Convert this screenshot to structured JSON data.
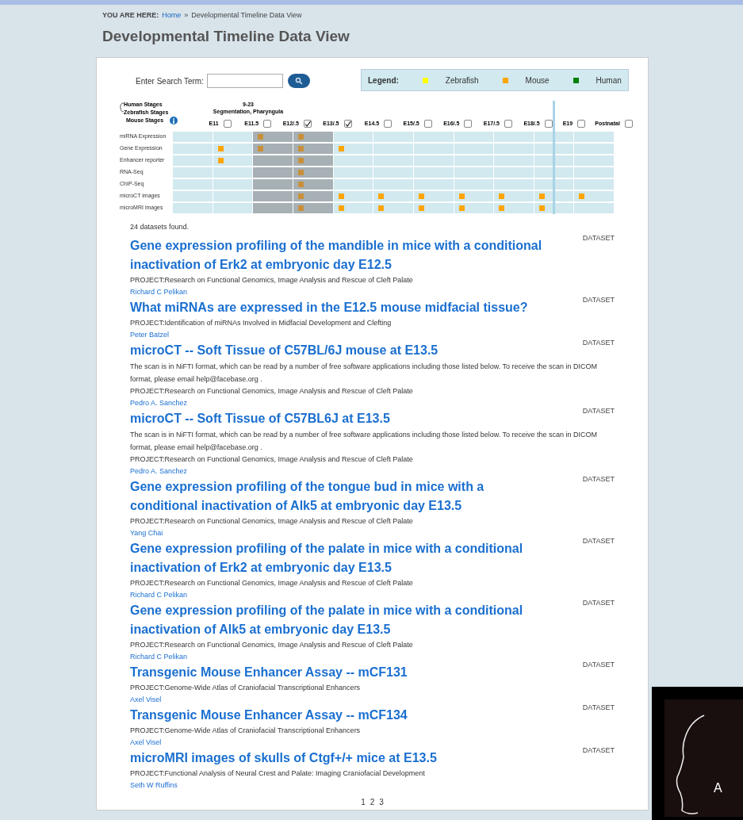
{
  "breadcrumb": {
    "label": "YOU ARE HERE:",
    "items": [
      {
        "text": "Home",
        "kind": "link"
      },
      {
        "text": "»",
        "kind": "sep"
      },
      {
        "text": "Developmental Timeline Data View",
        "kind": "current"
      }
    ]
  },
  "page_title": "Developmental Timeline Data View",
  "search": {
    "label": "Enter Search Term:"
  },
  "legend": {
    "title": "Legend:",
    "items": [
      {
        "label": "Zebrafish",
        "color": "#ffff00"
      },
      {
        "label": "Mouse",
        "color": "#ffa500"
      },
      {
        "label": "Human",
        "color": "#008000"
      }
    ]
  },
  "timeline": {
    "stage_labels": [
      "Human Stages",
      "Zebrafish Stages",
      "Mouse Stages"
    ],
    "zebrafish_stage": [
      "9-23",
      "Segmentation, Pharyngula"
    ],
    "columns": [
      {
        "label": "E11",
        "selected": false
      },
      {
        "label": "E11.5",
        "selected": false
      },
      {
        "label": "E12/.5",
        "selected": true
      },
      {
        "label": "E13/.5",
        "selected": true
      },
      {
        "label": "E14.5",
        "selected": false
      },
      {
        "label": "E15/.5",
        "selected": false
      },
      {
        "label": "E16/.5",
        "selected": false
      },
      {
        "label": "E17/.5",
        "selected": false
      },
      {
        "label": "E18/.5",
        "selected": false
      },
      {
        "label": "E19",
        "selected": false
      },
      {
        "label": "Postnatal",
        "selected": false
      }
    ],
    "rows": [
      {
        "label": "miRNA Expression",
        "cells": [
          false,
          false,
          true,
          true,
          false,
          false,
          false,
          false,
          false,
          false,
          false
        ]
      },
      {
        "label": "Gene Expression",
        "cells": [
          false,
          true,
          true,
          true,
          true,
          false,
          false,
          false,
          false,
          false,
          false
        ]
      },
      {
        "label": "Enhancer reporter",
        "cells": [
          false,
          true,
          false,
          true,
          false,
          false,
          false,
          false,
          false,
          false,
          false
        ]
      },
      {
        "label": "RNA-Seq",
        "cells": [
          false,
          false,
          false,
          true,
          false,
          false,
          false,
          false,
          false,
          false,
          false
        ]
      },
      {
        "label": "ChIP-Seq",
        "cells": [
          false,
          false,
          false,
          true,
          false,
          false,
          false,
          false,
          false,
          false,
          false
        ]
      },
      {
        "label": "microCT images",
        "cells": [
          false,
          false,
          false,
          true,
          true,
          true,
          true,
          true,
          true,
          true,
          true
        ]
      },
      {
        "label": "microMRI images",
        "cells": [
          false,
          false,
          false,
          true,
          true,
          true,
          true,
          true,
          true,
          true,
          false
        ]
      }
    ]
  },
  "results_count": "24 datasets found.",
  "datasets": [
    {
      "title": "Gene expression profiling of the mandible in mice with a conditional inactivation of Erk2 at embryonic day E12.5",
      "type": "DATASET",
      "project": "PROJECT:Research on Functional Genomics, Image Analysis and Rescue of Cleft Palate",
      "author": "Richard C Pelikan"
    },
    {
      "title": "What miRNAs are expressed in the E12.5 mouse midfacial tissue?",
      "type": "DATASET",
      "project": "PROJECT:Identification of miRNAs Involved in Midfacial Development and Clefting",
      "author": "Peter Batzel"
    },
    {
      "title": "microCT -- Soft Tissue of C57BL/6J mouse at E13.5",
      "type": "DATASET",
      "description": "The scan is in NiFTI format, which can be read by a number of free software applications including those listed below.  To receive the scan in DICOM format, please email help@facebase.org .",
      "project": "PROJECT:Research on Functional Genomics, Image Analysis and Rescue of Cleft Palate",
      "author": "Pedro A. Sanchez"
    },
    {
      "title": "microCT -- Soft Tissue of C57BL6J at E13.5",
      "type": "DATASET",
      "description": "The scan is in NiFTI format, which can be read by a number of free software applications including those listed below.  To receive the scan in DICOM format, please email help@facebase.org .",
      "project": "PROJECT:Research on Functional Genomics, Image Analysis and Rescue of Cleft Palate",
      "author": "Pedro A. Sanchez"
    },
    {
      "title": "Gene expression profiling of the tongue bud in mice with a conditional inactivation of Alk5 at embryonic day E13.5",
      "type": "DATASET",
      "project": "PROJECT:Research on Functional Genomics, Image Analysis and Rescue of Cleft Palate",
      "author": "Yang Chai"
    },
    {
      "title": "Gene expression profiling of the palate in mice with a conditional inactivation of Erk2 at embryonic day E13.5",
      "type": "DATASET",
      "project": "PROJECT:Research on Functional Genomics, Image Analysis and Rescue of Cleft Palate",
      "author": "Richard C Pelikan"
    },
    {
      "title": "Gene expression profiling of the palate in mice with a conditional inactivation of Alk5 at embryonic day E13.5",
      "type": "DATASET",
      "project": "PROJECT:Research on Functional Genomics, Image Analysis and Rescue of Cleft Palate",
      "author": "Richard C Pelikan"
    },
    {
      "title": "Transgenic Mouse Enhancer Assay -- mCF131",
      "type": "DATASET",
      "project": "PROJECT:Genome-Wide Atlas of Craniofacial Transcriptional Enhancers",
      "author": "Axel Visel"
    },
    {
      "title": "Transgenic Mouse Enhancer Assay -- mCF134",
      "type": "DATASET",
      "project": "PROJECT:Genome-Wide Atlas of Craniofacial Transcriptional Enhancers",
      "author": "Axel Visel"
    },
    {
      "title": "microMRI images of skulls of Ctgf+/+ mice at E13.5",
      "type": "DATASET",
      "project": "PROJECT:Functional Analysis of Neural Crest and Palate: Imaging Craniofacial Development",
      "author": "Seth W Ruffins"
    }
  ],
  "pagination": [
    "1",
    "2",
    "3"
  ],
  "logo": {
    "subtext": "A"
  }
}
